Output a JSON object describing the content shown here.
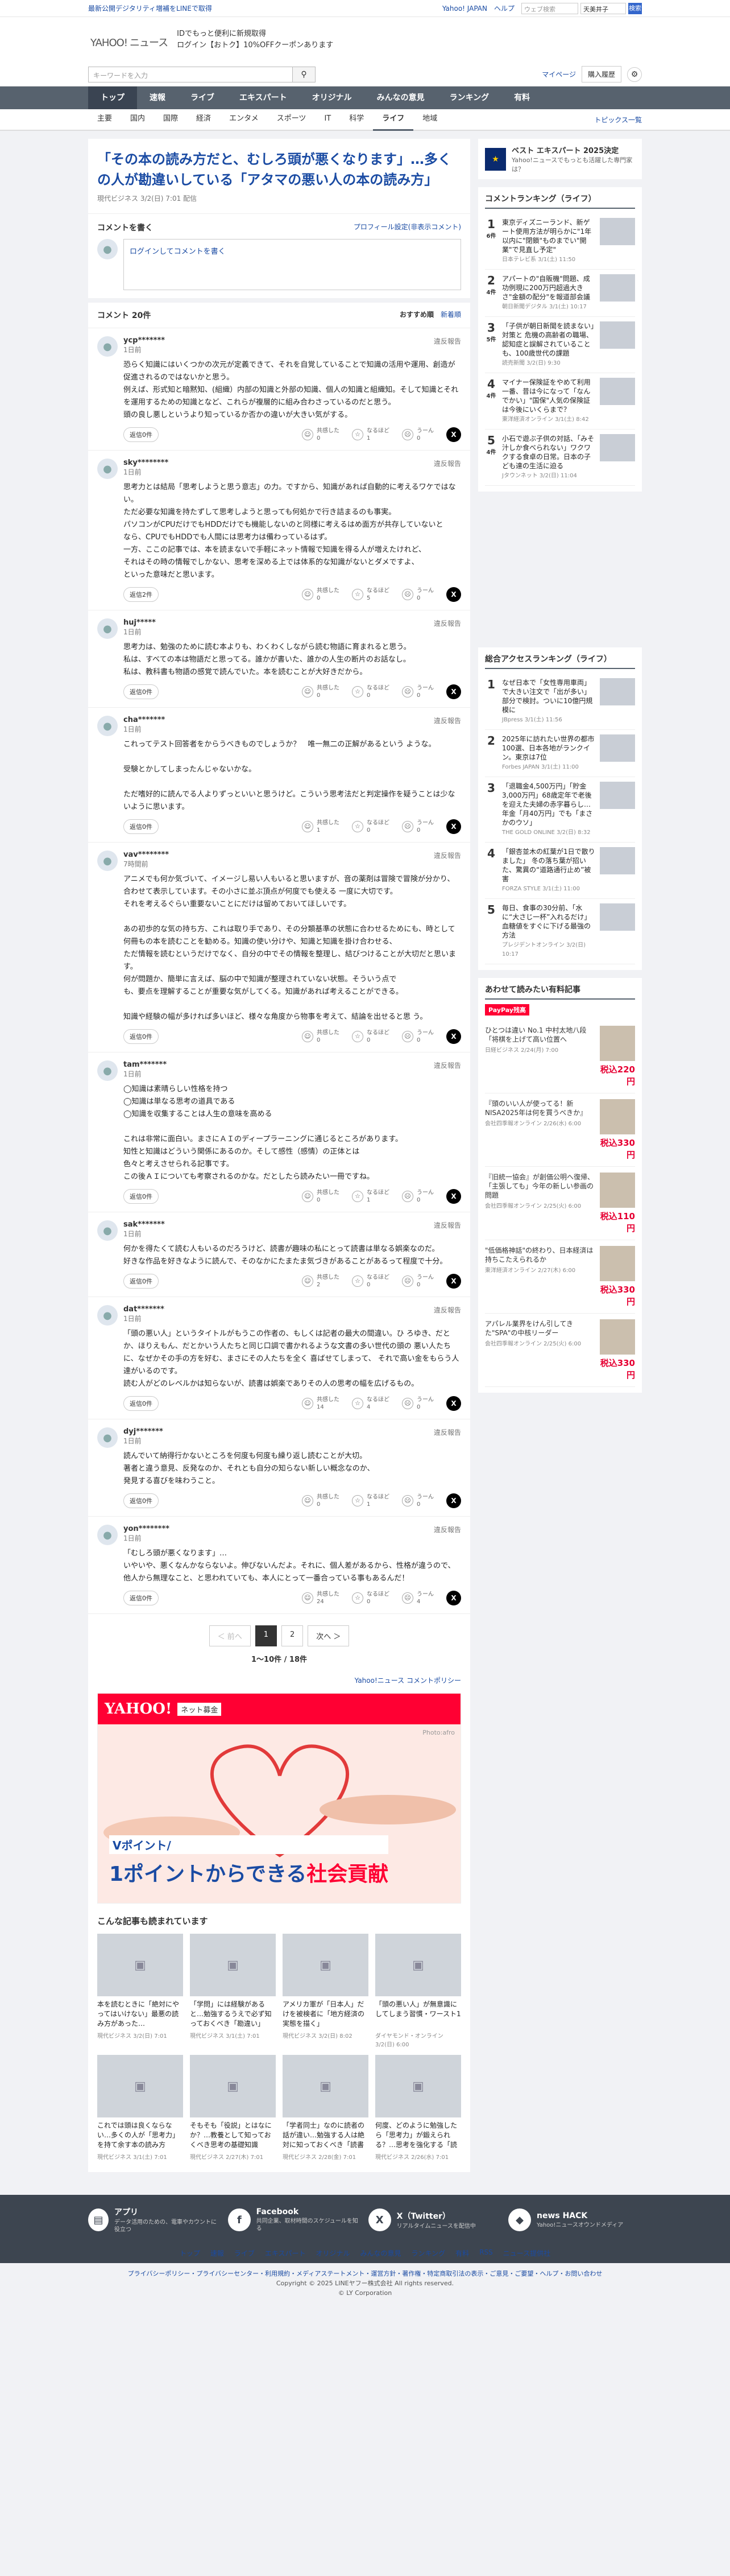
{
  "topbar": {
    "left": "最新公開デジタリティ増補をLINEで取得",
    "right": [
      "Yahoo! JAPAN",
      "ヘルプ"
    ],
    "search_placeholder": "ウェブ検索",
    "search_select": "天美井子",
    "search_btn": "検索"
  },
  "header": {
    "logo": "YAHOO!",
    "logo_sub": "ニュース",
    "promo1": "IDでもっと便利に新規取得",
    "promo2": "ログイン【おトク】10%OFFクーポンあります"
  },
  "subhead": {
    "keyword_placeholder": "キーワードを入力",
    "mypage": "マイページ",
    "purchase": "購入履歴"
  },
  "gnav": [
    "トップ",
    "速報",
    "ライブ",
    "エキスパート",
    "オリジナル",
    "みんなの意見",
    "ランキング",
    "有料"
  ],
  "cnav": {
    "items": [
      "主要",
      "国内",
      "国際",
      "経済",
      "エンタメ",
      "スポーツ",
      "IT",
      "科学",
      "ライフ",
      "地域"
    ],
    "active": "ライフ",
    "topics": "トピックス一覧"
  },
  "article": {
    "title": "「その本の読み方だと、むしろ頭が悪くなります」…多くの人が勘違いしている「アタマの悪い人の本の読み方」",
    "source": "現代ビジネス 3/2(日) 7:01 配信"
  },
  "write": {
    "heading": "コメントを書く",
    "profile_link": "プロフィール設定(非表示コメント)",
    "placeholder": "ログインしてコメントを書く"
  },
  "comments": {
    "count": "コメント 20件",
    "sort_rec": "おすすめ順",
    "sort_new": "新着順",
    "reply": "返信",
    "helpful": "共感した",
    "understand": "なるほど",
    "hmm": "うーん",
    "report": "違反報告",
    "items": [
      {
        "user": "ycp*******",
        "time": "1日前",
        "text": "恐らく知識にはいくつかの次元が定義できて、それを自覚していることで知識の活用や運用、創造が促進されるのではないかと思う。\n例えば、形式知と暗黙知、(組織）内部の知識と外部の知識、個人の知識と組織知。そして知識とそれを運用するための知識となど、これらが複層的に組み合わさっているのだと思う。\n頭の良し悪しというより知っているか否かの違いが大きい気がする。",
        "a": "0",
        "b": "1",
        "c": "0",
        "r": "返信0件"
      },
      {
        "user": "sky********",
        "time": "1日前",
        "text": "思考力とは結局「思考しようと思う意志」の力。ですから、知識があれば自動的に考えるワケではない。\nただ必要な知識を持たずして思考しようと思っても何処かで行き詰まるのも事実。\nパソコンがCPUだけでもHDDだけでも機能しないのと同様に考えるはめ面方が共存していないと\nなら、CPUでもHDDでも人間には思考力は備わっているはず。\n一方、ここの記事では、本を読まないで手軽にネット情報で知識を得る人が増えたけれど、\nそれはその時の情報でしかない、思考を深める上では体系的な知識がないとダメですよ、\nといった意味だと思います。",
        "a": "0",
        "b": "5",
        "c": "0",
        "r": "返信2件"
      },
      {
        "user": "huj*****",
        "time": "1日前",
        "text": "思考力は、勉強のために読む本よりも、わくわくしながら読む物語に育まれると思う。\n私は、すべての本は物語だと思ってる。誰かが書いた、誰かの人生の断片のお話なし。\n私は、教科書も物語の感覚で読んでいた。本を読むことが大好きだから。",
        "a": "0",
        "b": "0",
        "c": "0",
        "r": "返信0件"
      },
      {
        "user": "cha*******",
        "time": "1日前",
        "text": "これってテスト回答者をからうべきものでしょうか？　唯一無二の正解があるという ような。\n\n受験とかしてしまったんじゃないかな。\n\nただ嗜好的に読んでる人よりずっといいと思うけど。こういう思考法だと判定操作を疑うことは少ないように思います。",
        "a": "1",
        "b": "0",
        "c": "0",
        "r": "返信0件"
      },
      {
        "user": "vav********",
        "time": "7時間前",
        "text": "アニメでも何か気づいて、イメージし易い人もいると思いますが、音の薬剤は冒険で冒険が分かり、合わせて表示しています。その小さに並ぶ頂点が何度でも使える 一度に大切です。\nそれを考えるぐらい重要ないことにだけは留めておいてほしいです。\n\nあの初歩的な気の持ち方、これは取り手であり、その分類基準の状態に合わせるためにも、時として 何冊もの本を読むことを勧める。知識の使い分けや、知識と知識を掛け合わせる、\nただ情報を読むというだけでなく、自分の中でその情報を整理し、結びつけることが大切だと思います。\n何が問題か、簡単に言えば、脳の中で知識が整理されていない状態。そういう点で\nも、要点を理解することが重要な気がしてくる。知識があれば考えることができる。\n\n知識や経験の幅が多ければ多いほど、様々な角度から物事を考えて、結論を出せると思 う。",
        "a": "0",
        "b": "0",
        "c": "0",
        "r": "返信0件"
      },
      {
        "user": "tam*******",
        "time": "1日前",
        "text": "◯知識は素晴らしい性格を持つ\n◯知識は単なる思考の道具である\n◯知識を収集することは人生の意味を高める\n\nこれは非常に面白い。まさにＡＩのディープラーニングに通じるところがあります。\n知性と知識はどういう関係にあるのか。そして感性（感情）の正体とは\n色々と考えさせられる記事です。\nこの後ＡＩについても考察されるのかな。だとしたら読みたい一冊ですね。",
        "a": "0",
        "b": "1",
        "c": "0",
        "r": "返信0件"
      },
      {
        "user": "sak*******",
        "time": "1日前",
        "text": "何かを得たくて読む人もいるのだろうけど、読書が趣味の私にとって読書は単なる娯楽なのだ。\n好きな作品を好きなように読んで、そのなかにたまたま気づきがあることがあるって程度で十分。",
        "a": "2",
        "b": "0",
        "c": "0",
        "r": "返信0件"
      },
      {
        "user": "dat*******",
        "time": "1日前",
        "text": "「頭の悪い人」というタイトルがもうこの作者の、もしくは記者の最大の間違い。ひ ろゆき、だとか、ほりえもん、だとかいう人たちと同じ口調で書かれるような文書の多い世代の頭の 悪い人たちに、なぜかその手の方を好む、まさにその人たちを全く 喜ばせてしまって、 それで高い金をもらう人達がいるのです。\n読む人がどのレベルかは知らないが、読書は娯楽でありその人の思考の幅を広げるもの。",
        "a": "14",
        "b": "4",
        "c": "0",
        "r": "返信0件"
      },
      {
        "user": "dyj*******",
        "time": "1日前",
        "text": "読んでいて納得行かないところを何度も何度も繰り返し読むことが大切。\n著者と違う意見、反発なのか、それとも自分の知らない新しい概念なのか、\n発見する喜びを味わうこと。",
        "a": "0",
        "b": "1",
        "c": "0",
        "r": "返信0件"
      },
      {
        "user": "yon********",
        "time": "1日前",
        "text": "「むしろ頭が悪くなります」…\nいやいや、悪くなんかならないよ。伸びないんだよ。それに、個人差があるから、性格が違うので、他人から無理なこと、と思われていても、本人にとって一番合っている事もあるんだ！",
        "a": "24",
        "b": "0",
        "c": "4",
        "r": "返信0件"
      }
    ]
  },
  "pager": {
    "prev": "＜ 前へ",
    "p1": "1",
    "p2": "2",
    "next": "次へ ＞",
    "count": "1〜10件 / 18件"
  },
  "policy": "Yahoo!ニュース コメントポリシー",
  "ad": {
    "brand": "YAHOO!",
    "sub": "ネット募金",
    "credit": "Photo:afro",
    "copy1": "Vポイント/",
    "copy2a": "1ポイントからできる",
    "copy2b": "社会貢献"
  },
  "related": {
    "heading": "こんな記事も読まれています",
    "items": [
      {
        "t": "本を読むときに「絶対にやってはいけない」最悪の読み方があった…",
        "m": "現代ビジネス 3/2(日) 7:01"
      },
      {
        "t": "「学問」には経験があると…勉強するうえで必ず知っておくべき「勘違い」",
        "m": "現代ビジネス 3/1(土) 7:01"
      },
      {
        "t": "アメリカ軍が「日本人」だけを被検者に「地方経済の実態を描く」",
        "m": "現代ビジネス 3/2(日) 8:02"
      },
      {
        "t": "「頭の悪い人」が無意識にしてしまう習慣・ワースト1",
        "m": "ダイヤモンド・オンライン 3/2(日) 6:00"
      },
      {
        "t": "これでは頭は良くならない…多くの人が「思考力」を持て余す本の読み方",
        "m": "現代ビジネス 3/1(土) 7:01"
      },
      {
        "t": "そもそも「役説」とはなにか？…教養として知っておくべき思考の基礎知識",
        "m": "現代ビジネス 2/27(木) 7:01"
      },
      {
        "t": "「学者同士」なのに読者の話が違い…勉強する人は絶対に知っておくべき「読書術」",
        "m": "現代ビジネス 2/28(金) 7:01"
      },
      {
        "t": "何度、どのように勉強したら「思考力」が鍛えられる？…思考を強化する「読書」の正しい使い方",
        "m": "現代ビジネス 2/26(水) 7:01"
      }
    ]
  },
  "side": {
    "best": {
      "title": "ベスト エキスパート 2025決定",
      "sub": "Yahoo!ニュースでもっとも活躍した専門家は？"
    },
    "rank_title": "コメントランキング（ライフ）",
    "ranking": [
      {
        "n": "1",
        "c": "6件",
        "t": "東京ディズニーランド、新ゲート使用方法が明らかに\"1年以内に\"閉鎖\"ものまでい\"開業\"で見直し予定\"",
        "m": "日本テレビ系 3/1(土) 11:50"
      },
      {
        "n": "2",
        "c": "4件",
        "t": "アパートの\"自販機\"問題、成功例現に200万円超過大きさ\"金額の配分\"を報道部会議",
        "m": "朝日新聞デジタル 3/1(土) 10:17"
      },
      {
        "n": "3",
        "c": "5件",
        "t": "「子供が朝日新聞を読まない」対策と 危機の高齢者の職場、認知症と誤解されていることも、100歳世代の課題",
        "m": "読売新聞 3/2(日) 9:30"
      },
      {
        "n": "4",
        "c": "4件",
        "t": "マイナー保険証をやめて利用一番、昔は今になって「なんでかい」\"国保\"人気の保険証は今後にいくらまで？",
        "m": "東洋経済オンライン 3/1(土) 8:42"
      },
      {
        "n": "5",
        "c": "4件",
        "t": "小石で遊ぶ子供の対話、「みそ汁しか食べられない」ワクワクする食卓の日常。日本の子ども達の生活に迫る",
        "m": "Jタウンネット 3/2(日) 11:04"
      }
    ],
    "access_title": "総合アクセスランキング（ライフ）",
    "access": [
      {
        "n": "1",
        "t": "なぜ日本で「女性専用車両」で大きい注文で「出が多い」部分で検討。ついに10億円規模に",
        "m": "JBpress 3/1(土) 11:56"
      },
      {
        "n": "2",
        "t": "2025年に訪れたい世界の都市100選、日本各地がランクイン。東京は7位",
        "m": "Forbes JAPAN 3/1(土) 11:00"
      },
      {
        "n": "3",
        "t": "「退職金4,500万円」「貯金3,000万円」68歳定年で老後を迎えた夫婦の赤字暮らし…年金「月40万円」でも「まさかのウソ」",
        "m": "THE GOLD ONLINE 3/2(日) 8:32"
      },
      {
        "n": "4",
        "t": "「銀杏並木の紅葉が1日で散りました」 冬の落ち葉が招いた、驚異の“道路通行止め”被害",
        "m": "FORZA STYLE 3/1(土) 11:00"
      },
      {
        "n": "5",
        "t": "毎日、食事の30分前、「水に“大さじ一杯”入れるだけ」血糖値をすぐに下げる最強の方法",
        "m": "プレジデントオンライン 3/2(日) 10:17"
      }
    ],
    "promo_title": "あわせて読みたい有料記事",
    "paypay": "PayPay残高",
    "paid": [
      {
        "t": "ひとつは違い No.1 中村太地八段「将棋を上げて高い位置へ",
        "m": "日経ビジネス 2/24(月) 7:00",
        "p": "税込220円"
      },
      {
        "t": "『頭のいい人が使ってる！新NISA2025年は何を買うべきか』",
        "m": "会社四季報オンライン 2/26(水) 6:00",
        "p": "税込330円"
      },
      {
        "t": "『旧統一協会』が創価公明へ復帰、「主張しても」今年の新しい参画の問題",
        "m": "会社四季報オンライン 2/25(火) 6:00",
        "p": "税込110円"
      },
      {
        "t": "\"低価格神話\"の終わり、日本経済は持ちこたえられるか",
        "m": "東洋経済オンライン 2/27(木) 6:00",
        "p": "税込330円"
      },
      {
        "t": "アパレル業界をけん引してきた\"SPA\"の中核リーダー",
        "m": "会社四季報オンライン 2/25(火) 6:00",
        "p": "税込330円"
      }
    ]
  },
  "footer": {
    "apps": [
      {
        "t": "アプリ",
        "s": "データ活用のための、電車やカウントに役立つ"
      },
      {
        "t": "Facebook",
        "s": "共同企業、取材時間のスケジュールを知る"
      },
      {
        "t": "X（Twitter）",
        "s": "リアルタイムニュースを配信中"
      },
      {
        "t": "news HACK",
        "s": "Yahoo!ニュースオウンドメディア"
      }
    ],
    "links": [
      "トップ",
      "速報",
      "ライブ",
      "エキスパート",
      "オリジナル",
      "みんなの意見",
      "ランキング",
      "有料",
      "RSS",
      "ニュース提供社"
    ],
    "legal1": "プライバシーポリシー・プライバシーセンター・利用規約・メディアステートメント・運営方針・著作権・特定商取引法の表示・ご意見・ご要望・ヘルプ・お問い合わせ",
    "legal2": "Copyright © 2025 LINEヤフー株式会社 All rights reserved.",
    "legal3": "© LY Corporation"
  }
}
